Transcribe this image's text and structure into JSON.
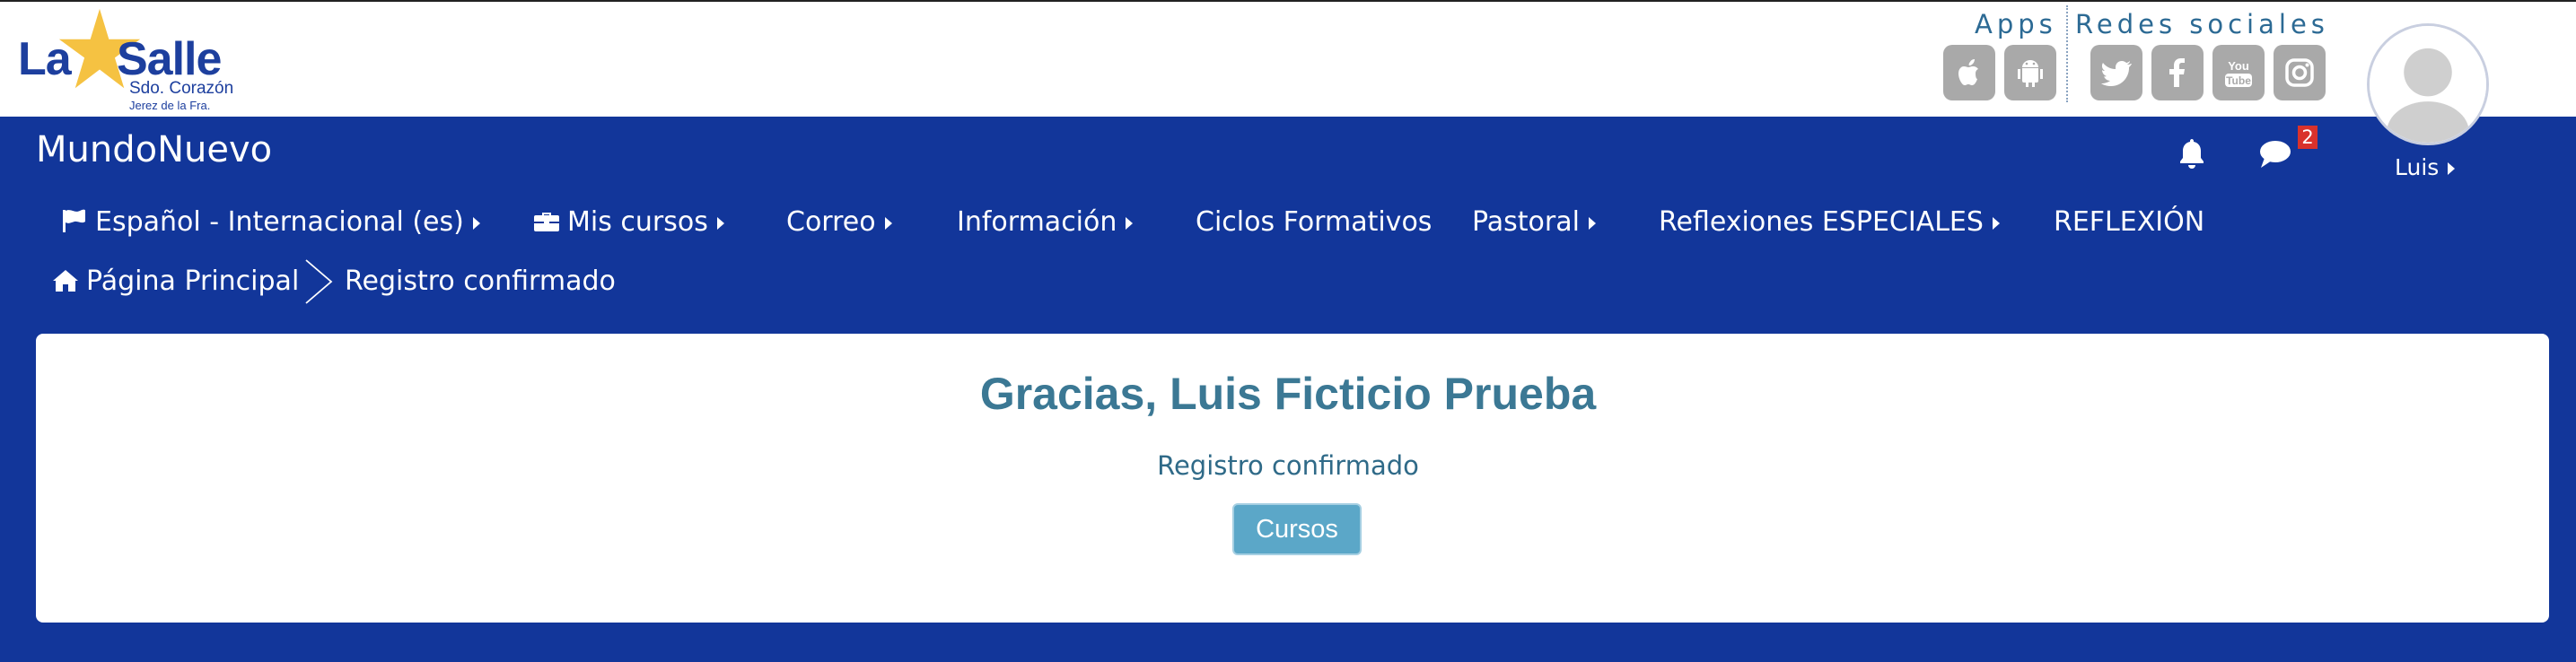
{
  "logo": {
    "brand_left": "La",
    "brand_right": "Salle",
    "subtitle": "Sdo. Corazón",
    "location": "Jerez de la Fra."
  },
  "header": {
    "apps_title": "Apps",
    "social_title": "Redes sociales",
    "app_icons": [
      "apple-icon",
      "android-icon"
    ],
    "social_icons": [
      "twitter-icon",
      "facebook-icon",
      "youtube-icon",
      "instagram-icon"
    ]
  },
  "navbar": {
    "site_name": "MundoNuevo",
    "message_count": "2",
    "user_name": "Luis"
  },
  "menu": {
    "language": "Español - Internacional (es)",
    "my_courses": "Mis cursos",
    "mail": "Correo",
    "info": "Información",
    "ciclos": "Ciclos Formativos",
    "pastoral": "Pastoral",
    "reflexiones": "Reflexiones ESPECIALES",
    "reflexion": "REFLEXIÓN"
  },
  "breadcrumb": {
    "home": "Página Principal",
    "current": "Registro confirmado"
  },
  "main": {
    "heading": "Gracias, Luis Ficticio Prueba",
    "message": "Registro confirmado",
    "button_label": "Cursos"
  },
  "colors": {
    "nav_background": "#12369a",
    "heading": "#3b7894",
    "button": "#5ba7c8",
    "icon_tiles": "#a9a9a9",
    "badge": "#d9322c"
  }
}
